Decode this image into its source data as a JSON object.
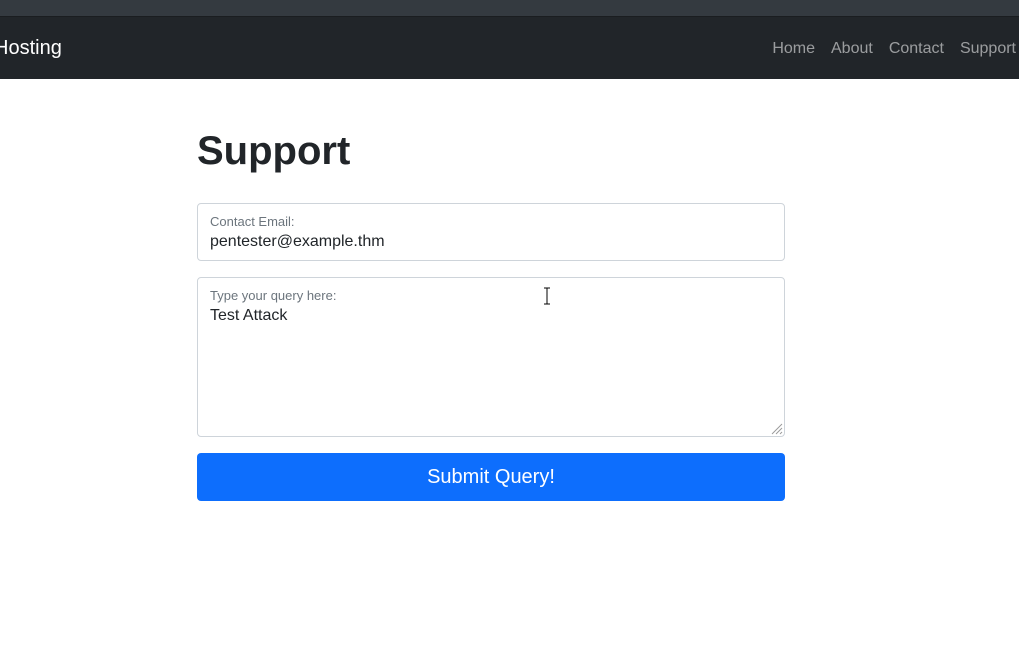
{
  "navbar": {
    "brand": "Hosting",
    "links": [
      "Home",
      "About",
      "Contact",
      "Support"
    ]
  },
  "page": {
    "title": "Support"
  },
  "form": {
    "email_label": "Contact Email:",
    "email_value": "pentester@example.thm",
    "query_label": "Type your query here:",
    "query_value": "Test Attack",
    "submit_label": "Submit Query!"
  },
  "colors": {
    "navbar_bg": "#212529",
    "primary": "#0d6efd",
    "nav_link": "rgba(255,255,255,0.55)"
  },
  "icons": {
    "cursor": "text-cursor-icon",
    "resize": "resize-grip-icon"
  }
}
